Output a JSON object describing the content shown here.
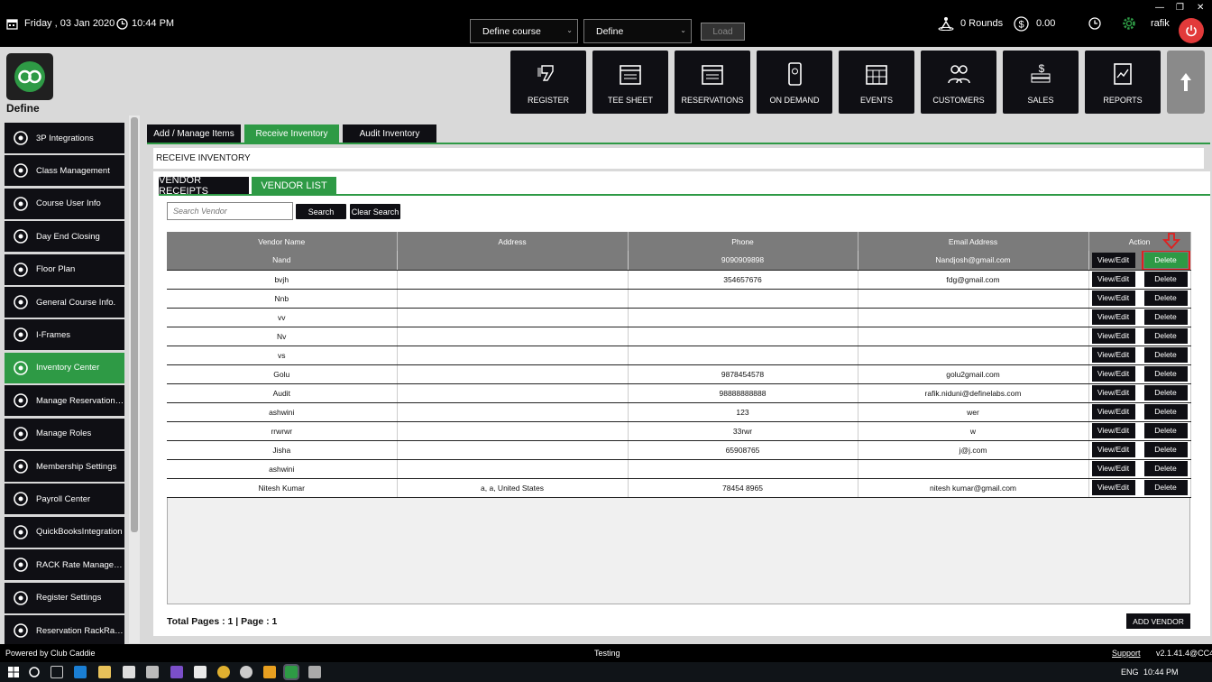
{
  "topbar": {
    "date": "Friday ,  03 Jan 2020",
    "time": "10:44 PM",
    "course_select": "Define  course",
    "define_select": "Define",
    "load_label": "Load",
    "rounds": "0 Rounds",
    "amount": "0.00",
    "user": "rafik"
  },
  "brand": "Define",
  "nav": [
    {
      "label": "REGISTER",
      "icon": "barcode-scanner-icon"
    },
    {
      "label": "TEE SHEET",
      "icon": "calendar-icon"
    },
    {
      "label": "RESERVATIONS",
      "icon": "calendar-icon"
    },
    {
      "label": "ON DEMAND",
      "icon": "mobile-icon"
    },
    {
      "label": "EVENTS",
      "icon": "calendar-grid-icon"
    },
    {
      "label": "CUSTOMERS",
      "icon": "users-icon"
    },
    {
      "label": "SALES",
      "icon": "money-icon"
    },
    {
      "label": "REPORTS",
      "icon": "report-icon"
    }
  ],
  "sidebar": [
    "3P Integrations",
    "Class Management",
    "Course User Info",
    "Day End Closing",
    "Floor Plan",
    "General Course Info.",
    "I-Frames",
    "Inventory Center",
    "Manage Reservation R...",
    "Manage Roles",
    "Membership Settings",
    "Payroll Center",
    "QuickBooksIntegration",
    "RACK Rate Manageme...",
    "Register Settings",
    "Reservation RackRate..."
  ],
  "tabs": [
    "Add / Manage Items",
    "Receive Inventory",
    "Audit Inventory"
  ],
  "section_title": "RECEIVE INVENTORY",
  "subtabs": [
    "VENDOR RECEIPTS",
    "VENDOR LIST"
  ],
  "search": {
    "placeholder": "Search Vendor",
    "search_label": "Search",
    "clear_label": "Clear Search"
  },
  "table": {
    "headers": [
      "Vendor Name",
      "Address",
      "Phone",
      "Email Address",
      "Action"
    ],
    "view_label": "View/Edit",
    "delete_label": "Delete",
    "rows": [
      [
        "Nand",
        "",
        "9090909898",
        "Nandjosh@gmail.com"
      ],
      [
        "bvjh",
        "",
        "354657676",
        "fdg@gmail.com"
      ],
      [
        "Nnb",
        "",
        "",
        ""
      ],
      [
        "vv",
        "",
        "",
        ""
      ],
      [
        "Nv",
        "",
        "",
        ""
      ],
      [
        "vs",
        "",
        "",
        ""
      ],
      [
        "Golu",
        "",
        "9878454578",
        "golu2gmail.com"
      ],
      [
        "Audit",
        "",
        "98888888888",
        "rafik.niduni@definelabs.com"
      ],
      [
        "ashwini",
        "",
        "123",
        "wer"
      ],
      [
        "rrwrwr",
        "",
        "33rwr",
        "w"
      ],
      [
        "Jisha",
        "",
        "65908765",
        "j@j.com"
      ],
      [
        "ashwini",
        "",
        "",
        ""
      ],
      [
        "Nitesh Kumar",
        "a, a, United States",
        "78454 8965",
        "nitesh kumar@gmail.com"
      ]
    ]
  },
  "totals": "Total Pages : 1 | Page : 1",
  "add_vendor_label": "ADD VENDOR",
  "footer": {
    "left": "Powered by Club Caddie",
    "center": "Testing",
    "support": "Support",
    "version": "v2.1.41.4@CC4"
  },
  "taskbar": {
    "lang": "ENG",
    "time": "10:44 PM"
  }
}
